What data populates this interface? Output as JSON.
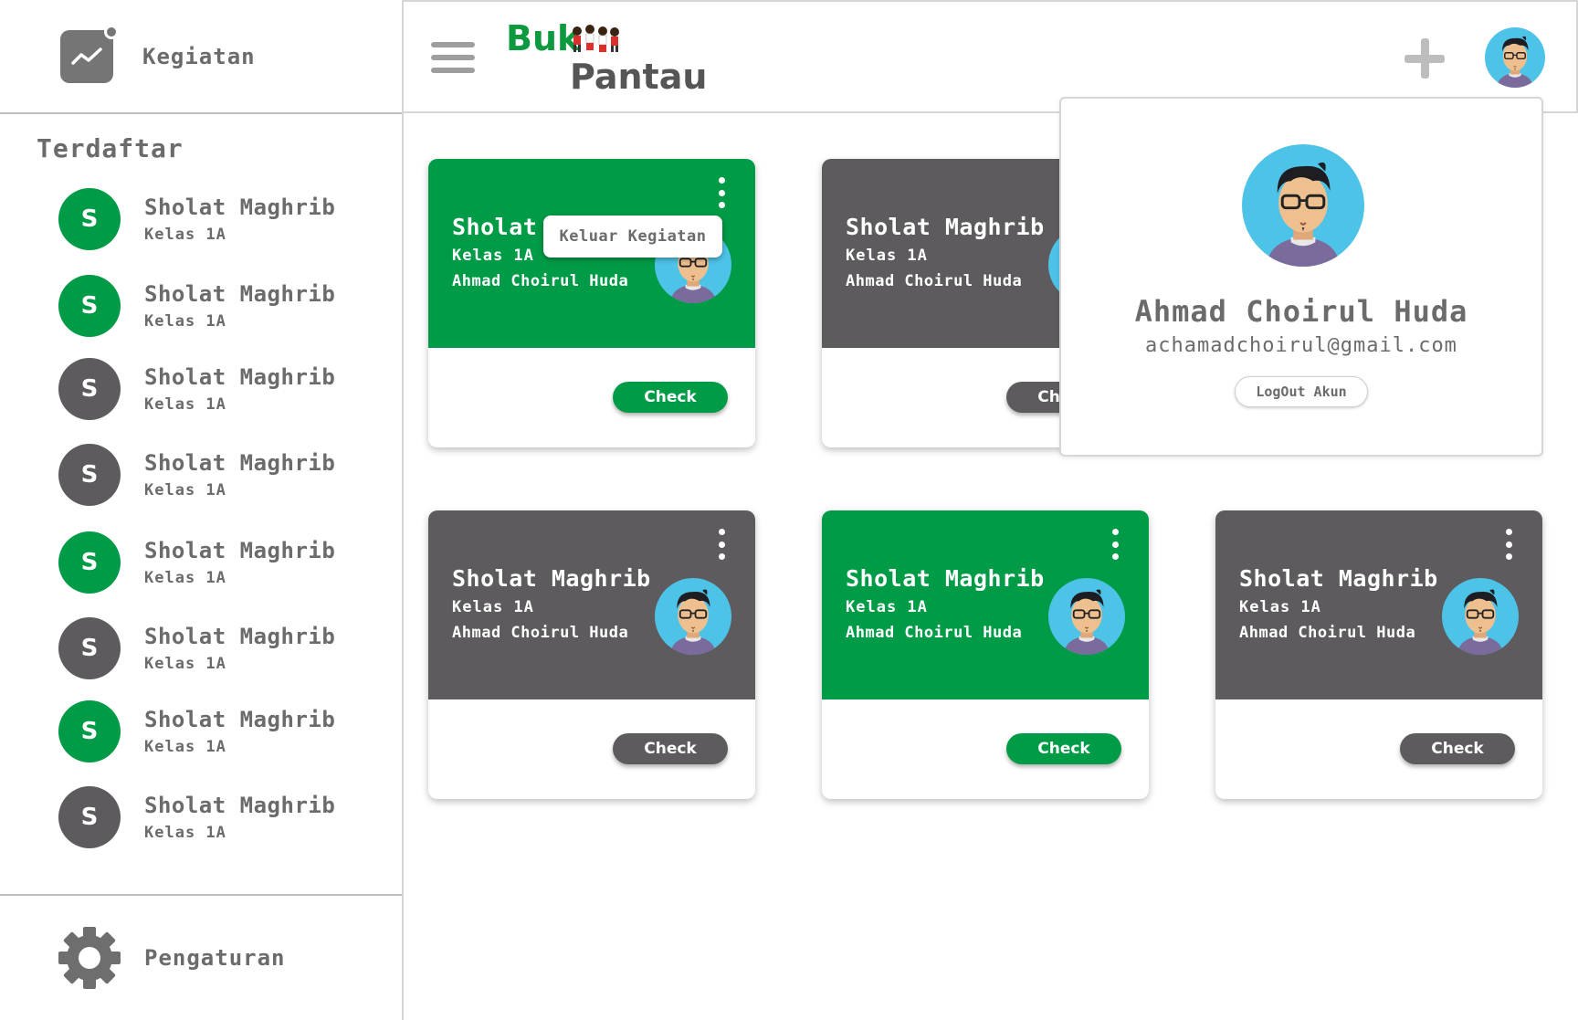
{
  "sidebar": {
    "activity_label": "Kegiatan",
    "section_title": "Terdaftar",
    "items": [
      {
        "initial": "S",
        "title": "Sholat Maghrib",
        "sub": "Kelas 1A",
        "color": "#009b46"
      },
      {
        "initial": "S",
        "title": "Sholat Maghrib",
        "sub": "Kelas 1A",
        "color": "#009b46"
      },
      {
        "initial": "S",
        "title": "Sholat Maghrib",
        "sub": "Kelas 1A",
        "color": "#5d5b5d"
      },
      {
        "initial": "S",
        "title": "Sholat Maghrib",
        "sub": "Kelas 1A",
        "color": "#5d5b5d"
      },
      {
        "initial": "S",
        "title": "Sholat Maghrib",
        "sub": "Kelas 1A",
        "color": "#009b46"
      },
      {
        "initial": "S",
        "title": "Sholat Maghrib",
        "sub": "Kelas 1A",
        "color": "#5d5b5d"
      },
      {
        "initial": "S",
        "title": "Sholat Maghrib",
        "sub": "Kelas 1A",
        "color": "#009b46"
      },
      {
        "initial": "S",
        "title": "Sholat Maghrib",
        "sub": "Kelas 1A",
        "color": "#5d5b5d"
      }
    ],
    "settings_label": "Pengaturan"
  },
  "header": {
    "logo_top": "Buk",
    "logo_bottom": "Pantau"
  },
  "cards": [
    {
      "title": "Sholat Maghrib",
      "class": "Kelas 1A",
      "teacher": "Ahmad Choirul Huda",
      "theme": "green",
      "check_label": "Check"
    },
    {
      "title": "Sholat Maghrib",
      "class": "Kelas 1A",
      "teacher": "Ahmad Choirul Huda",
      "theme": "gray",
      "check_label": "Check"
    },
    {
      "title": "Sholat Maghrib",
      "class": "Kelas 1A",
      "teacher": "Ahmad Choirul Huda",
      "theme": "gray",
      "check_label": "Check"
    },
    {
      "title": "Sholat Maghrib",
      "class": "Kelas 1A",
      "teacher": "Ahmad Choirul Huda",
      "theme": "green",
      "check_label": "Check"
    },
    {
      "title": "Sholat Maghrib",
      "class": "Kelas 1A",
      "teacher": "Ahmad Choirul Huda",
      "theme": "gray",
      "check_label": "Check"
    }
  ],
  "card_menu": {
    "leave_label": "Keluar Kegiatan"
  },
  "profile": {
    "name": "Ahmad Choirul Huda",
    "email": "achamadchoirul@gmail.com",
    "logout_label": "LogOut Akun"
  },
  "colors": {
    "accent_green": "#009b46",
    "card_gray": "#5d5b5d",
    "avatar_bg": "#4ec3e8"
  }
}
